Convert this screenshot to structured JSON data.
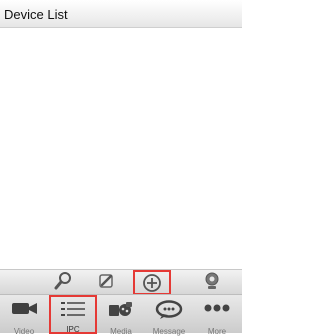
{
  "header": {
    "title": "Device List"
  },
  "toolbar": {
    "actions": [
      {
        "icon": "search-icon"
      },
      {
        "icon": "edit-icon"
      },
      {
        "icon": "add-icon"
      },
      {
        "icon": "camera-webcam-icon"
      }
    ]
  },
  "tabs": [
    {
      "label": "Video",
      "icon": "video-camera-icon"
    },
    {
      "label": "IPC",
      "icon": "list-icon"
    },
    {
      "label": "Media",
      "icon": "media-icon"
    },
    {
      "label": "Message",
      "icon": "message-icon"
    },
    {
      "label": "More",
      "icon": "more-icon"
    }
  ],
  "colors": {
    "highlight": "#e53935",
    "icon": "#444444"
  }
}
